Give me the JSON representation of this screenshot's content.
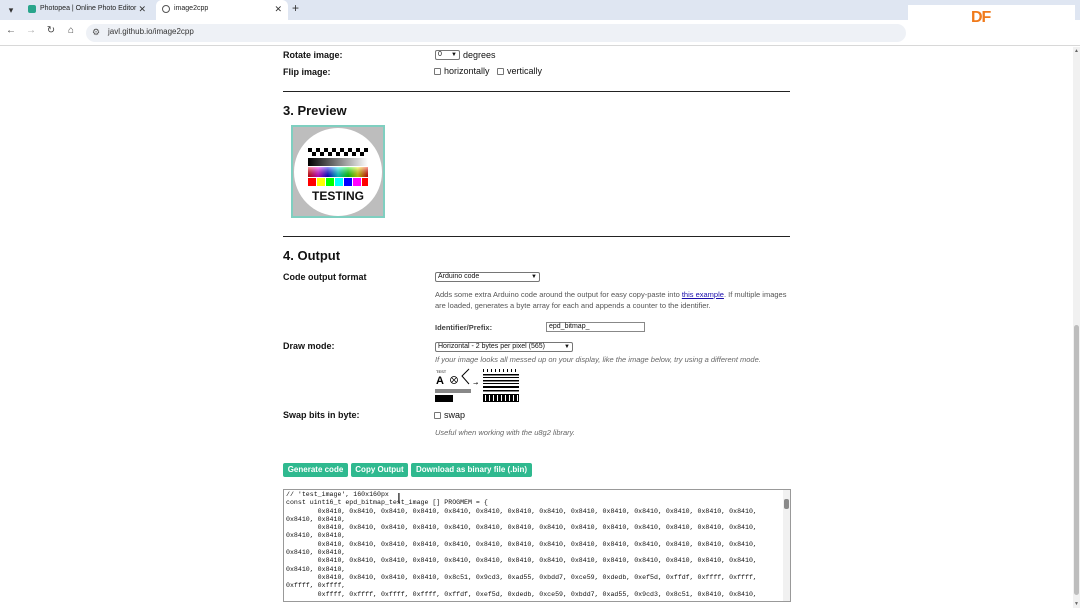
{
  "browser": {
    "tabs": [
      {
        "title": "Photopea | Online Photo Editor",
        "active": false
      },
      {
        "title": "image2cpp",
        "active": true
      }
    ],
    "url": "javl.github.io/image2cpp"
  },
  "watermark": {
    "text": "DF",
    "color": "#f07a1b"
  },
  "settings": {
    "rotate_label": "Rotate image:",
    "rotate_value": "0",
    "rotate_unit": "degrees",
    "flip_label": "Flip image:",
    "flip_h": "horizontally",
    "flip_v": "vertically"
  },
  "preview": {
    "heading": "3. Preview",
    "image_text": "TESTING"
  },
  "output": {
    "heading": "4. Output",
    "format_label": "Code output format",
    "format_value": "Arduino code",
    "format_desc_1": "Adds some extra Arduino code around the output for easy copy-paste into ",
    "format_desc_link": "this example",
    "format_desc_2": ". If multiple images are loaded, generates a byte array for each and appends a counter to the identifier.",
    "identifier_label": "Identifier/Prefix:",
    "identifier_value": "epd_bitmap_",
    "draw_mode_label": "Draw mode:",
    "draw_mode_value": "Horizontal - 2 bytes per pixel (565)",
    "draw_mode_hint": "If your image looks all messed up on your display, like the image below, try using a different mode.",
    "swap_label": "Swap bits in byte:",
    "swap_option": "swap",
    "swap_hint": "Useful when working with the u8g2 library.",
    "buttons": {
      "generate": "Generate code",
      "copy": "Copy Output",
      "download": "Download as binary file (.bin)"
    },
    "code": "// 'test_image', 160x160px\nconst uint16_t epd_bitmap_test_image [] PROGMEM = {\n\t0x8410, 0x8410, 0x8410, 0x8410, 0x8410, 0x8410, 0x8410, 0x8410, 0x8410, 0x8410, 0x8410, 0x8410, 0x8410, 0x8410,\n0x8410, 0x8410,\n\t0x8410, 0x8410, 0x8410, 0x8410, 0x8410, 0x8410, 0x8410, 0x8410, 0x8410, 0x8410, 0x8410, 0x8410, 0x8410, 0x8410,\n0x8410, 0x8410,\n\t0x8410, 0x8410, 0x8410, 0x8410, 0x8410, 0x8410, 0x8410, 0x8410, 0x8410, 0x8410, 0x8410, 0x8410, 0x8410, 0x8410,\n0x8410, 0x8410,\n\t0x8410, 0x8410, 0x8410, 0x8410, 0x8410, 0x8410, 0x8410, 0x8410, 0x8410, 0x8410, 0x8410, 0x8410, 0x8410, 0x8410,\n0x8410, 0x8410,\n\t0x8410, 0x8410, 0x8410, 0x8410, 0x8c51, 0x9cd3, 0xad55, 0xbdd7, 0xce59, 0xdedb, 0xef5d, 0xffdf, 0xffff, 0xffff,\n0xffff, 0xffff,\n\t0xffff, 0xffff, 0xffff, 0xffff, 0xffdf, 0xef5d, 0xdedb, 0xce59, 0xbdd7, 0xad55, 0x9cd3, 0x8c51, 0x8410, 0x8410,"
  }
}
